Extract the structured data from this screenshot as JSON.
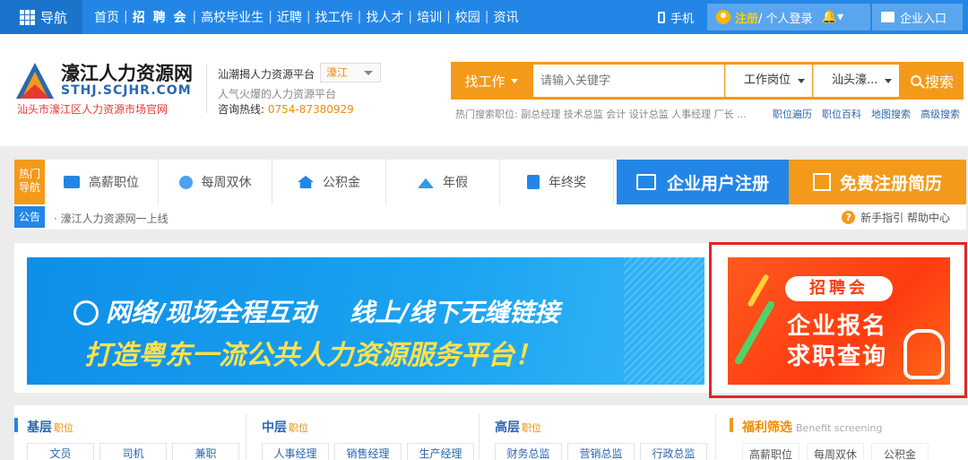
{
  "topnav": {
    "menu_label": "导航",
    "links": [
      "首页",
      "招 聘 会",
      "高校毕业生",
      "近聘",
      "找工作",
      "找人才",
      "培训",
      "校园",
      "资讯"
    ],
    "mobile_label": "手机",
    "register_label": "注册",
    "login_label": " / 个人登录",
    "enterprise_label": "企业入口",
    "colors": {
      "bar": "#2386e6",
      "register": "#ffcc00"
    }
  },
  "header": {
    "site_name": "濠江人力资源网",
    "domain": "STHJ.SCJHR.COM",
    "official_tag": "汕头市濠江区人力资源市场官网",
    "platform_label": "汕潮揭人力资源平台",
    "region_value": "濠江",
    "slogan": "人气火爆的人力资源平台",
    "hotline_label": "咨询热线: ",
    "hotline_number": "0754-87380929"
  },
  "search": {
    "category_label": "找工作",
    "placeholder": "请输入关键字",
    "position_select": "工作岗位",
    "area_select": "汕头濠...",
    "button_label": "搜索",
    "hot_search": "热门搜索职位: 副总经理 技术总监 会计 设计总监 人事经理 厂长 ...",
    "quick_links": [
      "职位遍历",
      "职位百科",
      "地图搜索",
      "高级搜索"
    ]
  },
  "strip": {
    "hot_tag": "热门导航",
    "categories": [
      "高薪职位",
      "每周双休",
      "公积金",
      "年假",
      "年终奖"
    ],
    "register_enterprise": "企业用户注册",
    "register_resume": "免费注册简历"
  },
  "notice": {
    "tag": "公告",
    "text": "· 濠江人力资源网一上线",
    "help_links": "新手指引  帮助中心"
  },
  "banner": {
    "line1_a": "网络/现场全程互动",
    "line1_b": "线上/线下无缝链接",
    "line2": "打造粤东一流公共人力资源服务平台！"
  },
  "promo": {
    "pill": "招聘会",
    "line1": "企业报名",
    "line2": "求职查询"
  },
  "jobs": {
    "columns": [
      {
        "title": "基层",
        "suffix": "职位",
        "items": [
          "文员",
          "司机",
          "兼职"
        ]
      },
      {
        "title": "中层",
        "suffix": "职位",
        "items": [
          "人事经理",
          "销售经理",
          "生产经理"
        ]
      },
      {
        "title": "高层",
        "suffix": "职位",
        "items": [
          "财务总监",
          "营销总监",
          "行政总监"
        ]
      }
    ],
    "welfare": {
      "title": "福利筛选",
      "subtitle": "Benefit screening",
      "items": [
        "高薪职位",
        "每周双休",
        "公积金"
      ]
    }
  }
}
